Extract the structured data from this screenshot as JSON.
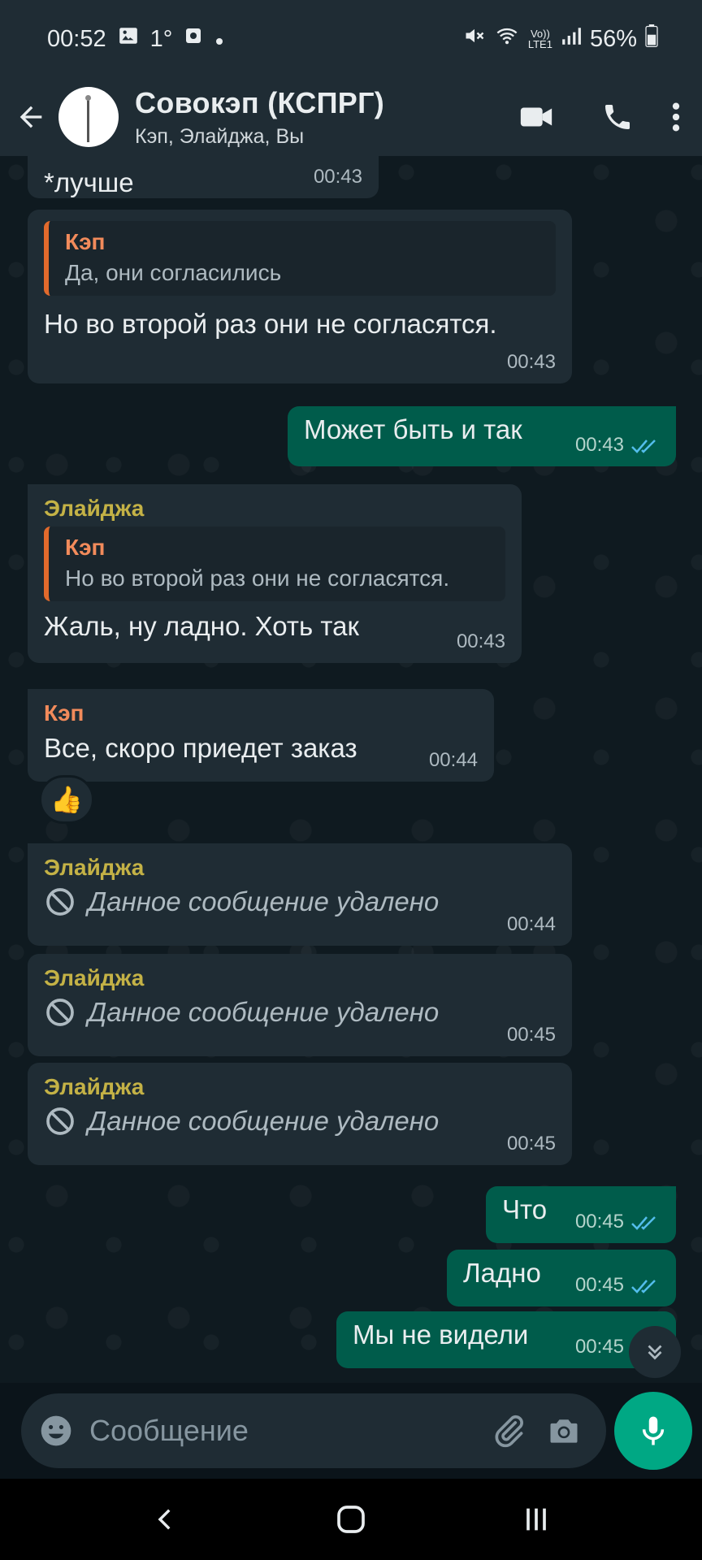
{
  "status_bar": {
    "time": "00:52",
    "temperature": "1°",
    "battery_percent": "56%",
    "network": "LTE1",
    "icons": [
      "gallery-icon",
      "thermometer-icon",
      "dot-icon",
      "mute-icon",
      "wifi-icon",
      "volte-icon",
      "signal-icon",
      "battery-icon"
    ]
  },
  "header": {
    "title": "Совокэп (КСПРГ)",
    "subtitle": "Кэп, Элайджа, Вы",
    "icons": [
      "back-arrow-icon",
      "video-call-icon",
      "phone-icon",
      "more-vert-icon"
    ]
  },
  "messages": [
    {
      "type": "incoming",
      "text": "*лучше",
      "time": "00:43"
    },
    {
      "type": "incoming",
      "quote": {
        "name": "Кэп",
        "text": "Да, они согласились"
      },
      "text": "Но во второй раз они не согласятся.",
      "time": "00:43"
    },
    {
      "type": "outgoing",
      "text": "Может быть и так",
      "time": "00:43",
      "status": "read"
    },
    {
      "type": "incoming",
      "sender": "Элайджа",
      "quote": {
        "name": "Кэп",
        "text": "Но во второй раз они не согласятся."
      },
      "text": "Жаль, ну ладно. Хоть так",
      "time": "00:43"
    },
    {
      "type": "incoming",
      "sender": "Кэп",
      "text": "Все, скоро приедет заказ",
      "time": "00:44",
      "reaction": "👍"
    },
    {
      "type": "incoming",
      "sender": "Элайджа",
      "deleted": true,
      "text": "Данное сообщение удалено",
      "time": "00:44"
    },
    {
      "type": "incoming",
      "sender": "Элайджа",
      "deleted": true,
      "text": "Данное сообщение удалено",
      "time": "00:45"
    },
    {
      "type": "incoming",
      "sender": "Элайджа",
      "deleted": true,
      "text": "Данное сообщение удалено",
      "time": "00:45"
    },
    {
      "type": "outgoing",
      "text": "Что",
      "time": "00:45",
      "status": "read"
    },
    {
      "type": "outgoing",
      "text": "Ладно",
      "time": "00:45",
      "status": "read"
    },
    {
      "type": "outgoing",
      "text": "Мы не видели",
      "time": "00:45",
      "status": "read"
    }
  ],
  "composer": {
    "placeholder": "Сообщение",
    "icons": [
      "emoji-icon",
      "attach-icon",
      "camera-icon",
      "mic-icon"
    ]
  },
  "colors": {
    "incoming_bubble": "#1f2c34",
    "outgoing_bubble": "#005c4b",
    "accent": "#00a884",
    "sender_elijah": "#c4b246",
    "sender_kep": "#f28b5b",
    "read_ticks": "#53bdeb"
  }
}
